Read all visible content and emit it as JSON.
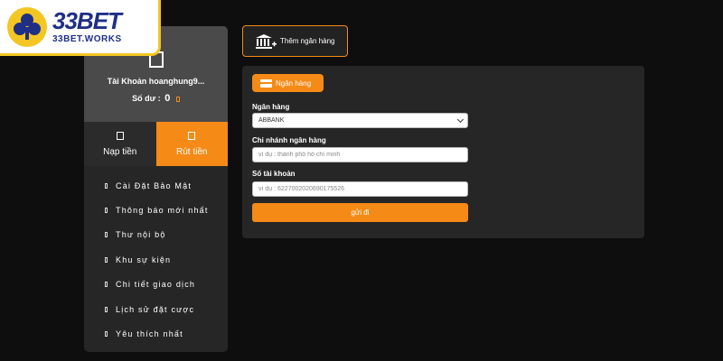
{
  "brand": {
    "logo_main": "33BET",
    "logo_sub": "33BET.WORKS"
  },
  "account": {
    "name": "Tài Khoản hoanghung9...",
    "balance_label": "Số dư :",
    "balance_value": "0"
  },
  "tabs": [
    {
      "label": "Nạp tiền",
      "active": false
    },
    {
      "label": "Rút tiền",
      "active": true
    }
  ],
  "menu": [
    "Cài Đặt Bảo Mật",
    "Thông báo mới nhất",
    "Thư nội bộ",
    "Khu sự kiện",
    "Chi tiết giao dịch",
    "Lịch sử đặt cược",
    "Yêu thích nhất"
  ],
  "add_bank_label": "Thêm ngân hàng",
  "form": {
    "pill_label": "Ngân hàng",
    "bank_label": "Ngân hàng",
    "bank_value": "ABBANK",
    "branch_label": "Chi nhánh ngân hàng",
    "branch_placeholder": "ví dụ : thành phố hồ chí minh",
    "account_label": "Số tài khoản",
    "account_placeholder": "ví dụ : 6227002020690175526",
    "submit_label": "gửi đi"
  },
  "colors": {
    "accent": "#f58a17",
    "sidebar_bg": "#262626",
    "page_bg": "#0e0e0e"
  }
}
